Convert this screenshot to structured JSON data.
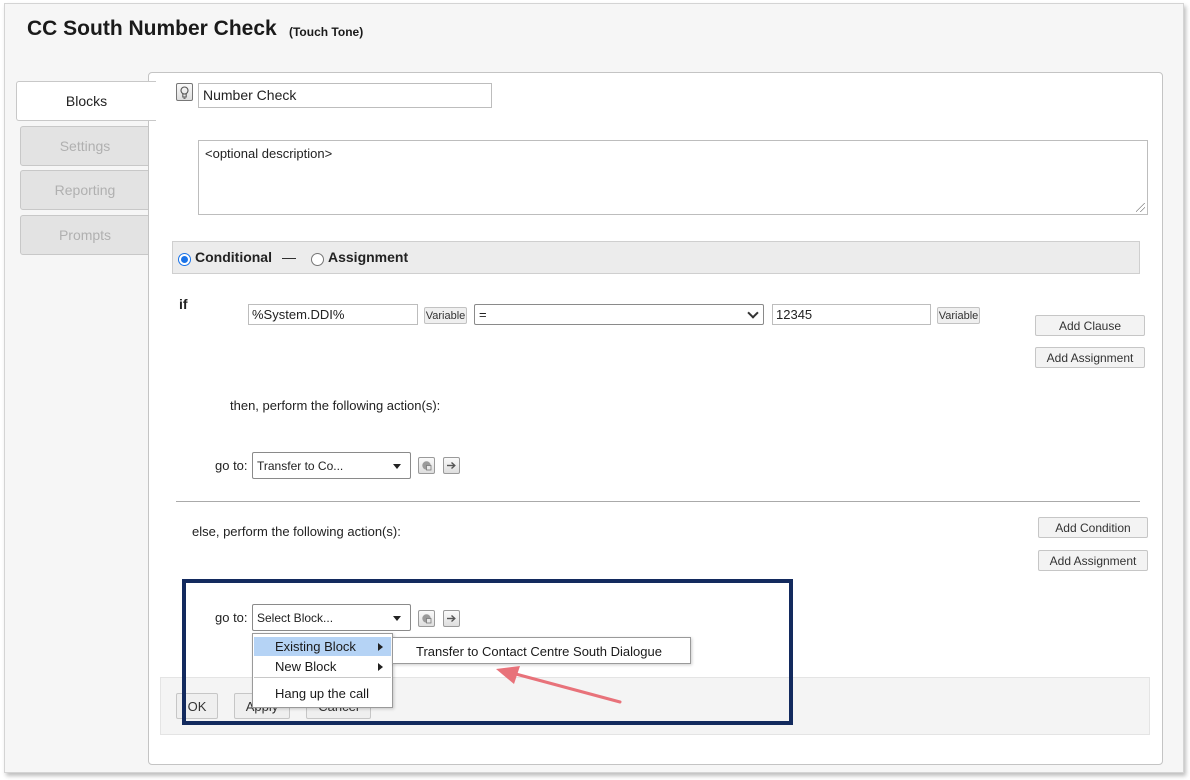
{
  "header": {
    "title": "CC South Number Check",
    "subtitle": "(Touch Tone)"
  },
  "tabs": [
    {
      "label": "Blocks",
      "active": true
    },
    {
      "label": "Settings",
      "active": false
    },
    {
      "label": "Reporting",
      "active": false
    },
    {
      "label": "Prompts",
      "active": false
    }
  ],
  "block": {
    "name_value": "Number Check",
    "description_value": "<optional description>",
    "icon": "lightbulb-icon"
  },
  "type_selector": {
    "conditional_label": "Conditional",
    "separator": "—",
    "assignment_label": "Assignment",
    "selected": "Conditional"
  },
  "condition": {
    "if_label": "if",
    "left_value": "%System.DDI%",
    "left_variable_btn": "Variable",
    "operator": "=",
    "right_value": "12345",
    "right_variable_btn": "Variable",
    "add_clause_btn": "Add Clause",
    "add_assignment_btn": "Add Assignment"
  },
  "then": {
    "label": "then, perform the following action(s):",
    "goto_label": "go to:",
    "goto_value": "Transfer to Co..."
  },
  "else": {
    "label": "else, perform the following action(s):",
    "add_condition_btn": "Add Condition",
    "add_assignment_btn": "Add Assignment",
    "goto_label": "go to:",
    "goto_value": "Select Block..."
  },
  "context_menu": {
    "items": [
      {
        "label": "Existing Block",
        "has_submenu": true,
        "highlighted": true
      },
      {
        "label": "New Block",
        "has_submenu": true,
        "highlighted": false
      },
      {
        "label": "Hang up the call",
        "has_submenu": false,
        "highlighted": false
      }
    ],
    "submenu_item": "Transfer to Contact Centre South Dialogue"
  },
  "footer": {
    "ok": "OK",
    "apply": "Apply",
    "cancel": "Cancel"
  },
  "colors": {
    "highlight_border": "#132a5e",
    "annotation_arrow": "#e8727a",
    "menu_highlight": "#b5d3f5",
    "radio_selected": "#1a73e8"
  }
}
